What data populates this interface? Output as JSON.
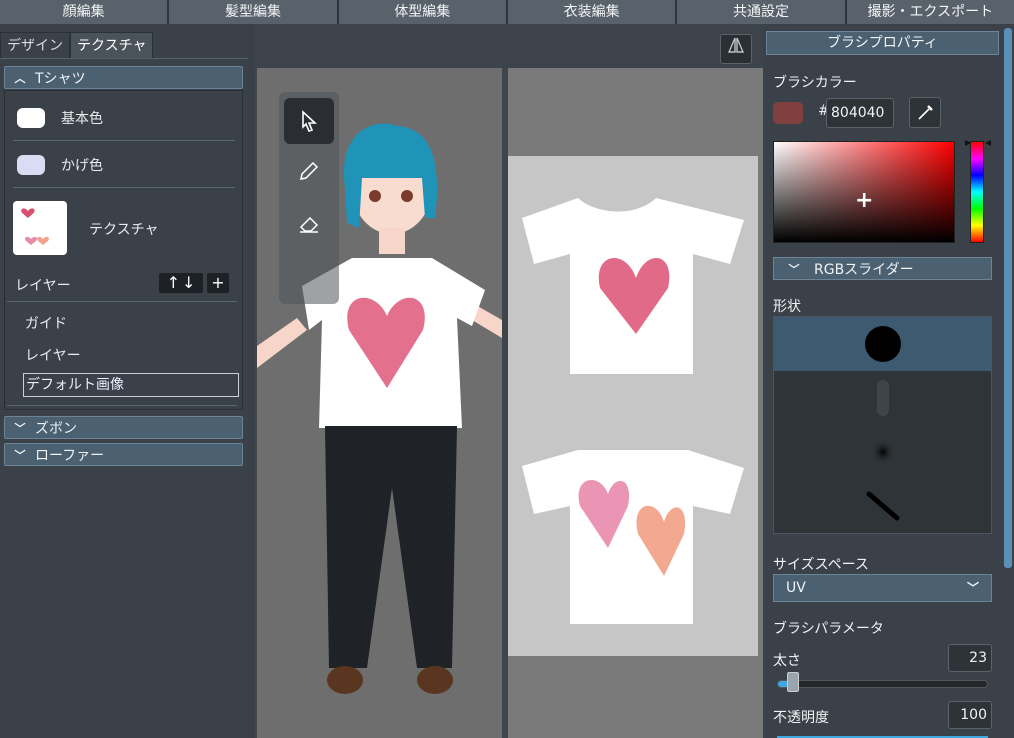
{
  "top_menu": [
    "顔編集",
    "髪型編集",
    "体型編集",
    "衣装編集",
    "共通設定",
    "撮影・エクスポート"
  ],
  "left": {
    "tabs": [
      "デザイン",
      "テクスチャ"
    ],
    "sections": {
      "tshirt": "Tシャツ",
      "pants": "ズボン",
      "shoes": "ローファー"
    },
    "base_color_label": "基本色",
    "base_color": "#ffffff",
    "shade_color_label": "かげ色",
    "shade_color": "#d9dcf2",
    "texture_label": "テクスチャ",
    "layers_label": "レイヤー",
    "layer_up": "↑",
    "layer_down": "↓",
    "layer_add": "+",
    "layer_items": [
      "ガイド",
      "レイヤー"
    ],
    "layer_edit_value": "デフォルト画像"
  },
  "viewport": {
    "mirror_icon": "⏅",
    "tools": [
      "pointer-icon",
      "pencil-icon",
      "eraser-icon"
    ]
  },
  "right": {
    "title": "ブラシプロパティ",
    "brush_color_label": "ブラシカラー",
    "brush_color": "#804040",
    "hash": "#",
    "hex_value": "804040",
    "rgb_slider_label": "RGBスライダー",
    "shape_label": "形状",
    "size_space_label": "サイズスペース",
    "size_space_value": "UV",
    "brush_params_label": "ブラシパラメータ",
    "thickness_label": "太さ",
    "thickness_value": "23",
    "thickness_fraction": 0.08,
    "opacity_label": "不透明度",
    "opacity_value": "100"
  }
}
